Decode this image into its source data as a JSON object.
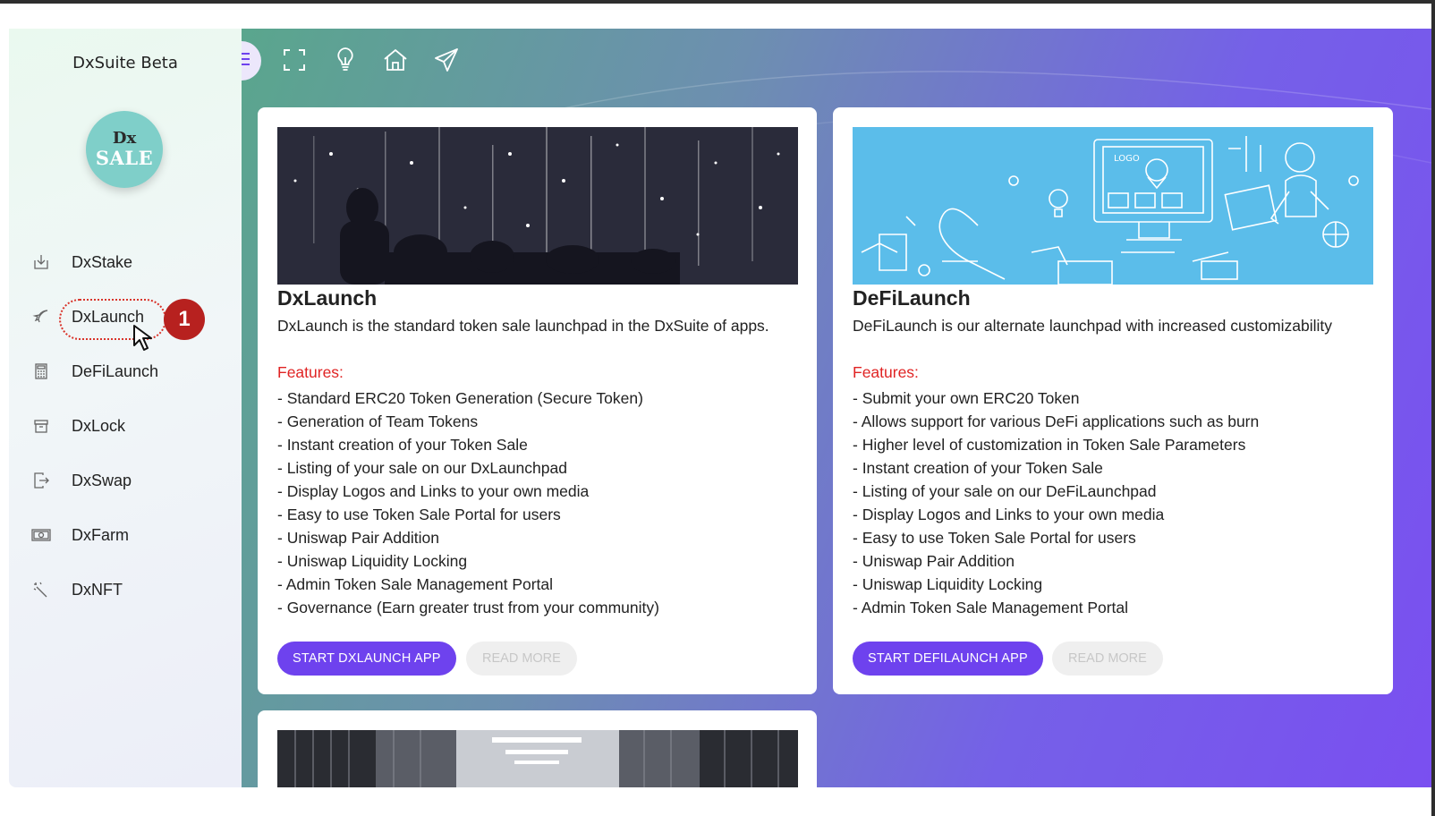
{
  "sidebar": {
    "brand": "DxSuite Beta",
    "logo_line1": "Dx",
    "logo_line2": "SALE",
    "items": [
      {
        "label": "DxStake",
        "icon": "download-box-icon"
      },
      {
        "label": "DxLaunch",
        "icon": "rocket-icon"
      },
      {
        "label": "DeFiLaunch",
        "icon": "calculator-icon"
      },
      {
        "label": "DxLock",
        "icon": "archive-icon"
      },
      {
        "label": "DxSwap",
        "icon": "exit-icon"
      },
      {
        "label": "DxFarm",
        "icon": "money-icon"
      },
      {
        "label": "DxNFT",
        "icon": "magic-wand-icon"
      }
    ],
    "step_badge": "1"
  },
  "toolbar": {
    "icons": [
      "menu-icon",
      "fullscreen-icon",
      "lightbulb-icon",
      "home-icon",
      "send-icon"
    ]
  },
  "cards": [
    {
      "title": "DxLaunch",
      "description": "DxLaunch is the standard token sale launchpad in the DxSuite of apps.",
      "features_label": "Features:",
      "features": [
        "- Standard ERC20 Token Generation (Secure Token)",
        "- Generation of Team Tokens",
        "- Instant creation of your Token Sale",
        "- Listing of your sale on our DxLaunchpad",
        "- Display Logos and Links to your own media",
        "- Easy to use Token Sale Portal for users",
        "- Uniswap Pair Addition",
        "- Uniswap Liquidity Locking",
        "- Admin Token Sale Management Portal",
        "- Governance (Earn greater trust from your community)"
      ],
      "primary_button": "START DXLAUNCH APP",
      "secondary_button": "READ MORE"
    },
    {
      "title": "DeFiLaunch",
      "description": "DeFiLaunch is our alternate launchpad with increased customizability",
      "features_label": "Features:",
      "features": [
        "- Submit your own ERC20 Token",
        "- Allows support for various DeFi applications such as burn",
        "- Higher level of customization in Token Sale Parameters",
        "- Instant creation of your Token Sale",
        "- Listing of your sale on our DeFiLaunchpad",
        "- Display Logos and Links to your own media",
        "- Easy to use Token Sale Portal for users",
        "- Uniswap Pair Addition",
        "- Uniswap Liquidity Locking",
        "- Admin Token Sale Management Portal"
      ],
      "primary_button": "START DEFILAUNCH APP",
      "secondary_button": "READ MORE",
      "banner_logo_text": "LOGO"
    }
  ],
  "colors": {
    "accent": "#6e42ee",
    "features_label": "#e02424",
    "step_badge": "#b7211f",
    "logo_circle": "#7fcfc9"
  }
}
